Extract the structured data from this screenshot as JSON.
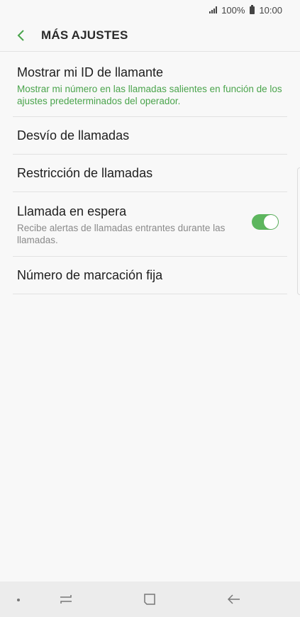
{
  "status_bar": {
    "battery": "100%",
    "time": "10:00"
  },
  "header": {
    "title": "MÁS AJUSTES",
    "back_icon": "chevron-left-icon"
  },
  "items": [
    {
      "title": "Mostrar mi ID de llamante",
      "subtitle": "Mostrar mi número en las llamadas salientes en función de los ajustes predeterminados del operador."
    },
    {
      "title": "Desvío de llamadas"
    },
    {
      "title": "Restricción de llamadas"
    },
    {
      "title": "Llamada en espera",
      "subtitle": "Recibe alertas de llamadas entrantes durante las llamadas.",
      "toggle_on": true
    },
    {
      "title": "Número de marcación fija"
    }
  ],
  "colors": {
    "accent": "#4aa44c",
    "toggle": "#5db65e",
    "background": "#f8f8f8"
  },
  "nav_bar": {
    "icons": [
      "recents-icon",
      "home-icon",
      "back-arrow-icon"
    ]
  }
}
